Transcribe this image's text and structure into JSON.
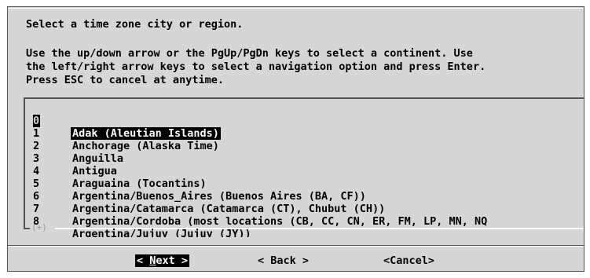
{
  "prompt": {
    "title_line": "Select a time zone city or region.",
    "instructions": [
      "Use the up/down arrow or the PgUp/PgDn keys to select a continent. Use",
      "the left/right arrow keys to select a navigation option and press Enter.",
      "Press ESC to cancel at anytime."
    ]
  },
  "list": {
    "items": [
      {
        "index": "0",
        "label": "Adak (Aleutian Islands)"
      },
      {
        "index": "1",
        "label": "Anchorage (Alaska Time)"
      },
      {
        "index": "2",
        "label": "Anguilla"
      },
      {
        "index": "3",
        "label": "Antigua"
      },
      {
        "index": "4",
        "label": "Araguaina (Tocantins)"
      },
      {
        "index": "5",
        "label": "Argentina/Buenos_Aires (Buenos Aires (BA, CF))"
      },
      {
        "index": "6",
        "label": "Argentina/Catamarca (Catamarca (CT), Chubut (CH))"
      },
      {
        "index": "7",
        "label": "Argentina/Cordoba (most locations (CB, CC, CN, ER, FM, LP, MN, NQ"
      },
      {
        "index": "8",
        "label": "Argentina/Jujuy (Jujuy (JY))"
      }
    ],
    "selected_index": 0,
    "scroll_indicator": "(+)"
  },
  "buttons": {
    "next": {
      "open": "< ",
      "hotkey": "N",
      "rest": "ext",
      "close": " >"
    },
    "back": "< Back >",
    "cancel": "<Cancel>"
  },
  "colors": {
    "dialog_background": "#d6d6d6",
    "selection_background": "#000000",
    "selection_text": "#ffffff"
  }
}
